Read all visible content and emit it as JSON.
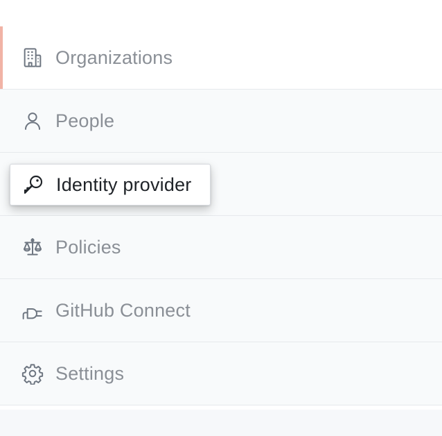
{
  "sidebar": {
    "items": [
      {
        "label": "Organizations",
        "icon": "organization-icon"
      },
      {
        "label": "People",
        "icon": "person-icon"
      },
      {
        "label": "Identity provider",
        "icon": "key-icon"
      },
      {
        "label": "Policies",
        "icon": "law-icon"
      },
      {
        "label": "GitHub Connect",
        "icon": "plug-icon"
      },
      {
        "label": "Settings",
        "icon": "gear-icon"
      }
    ],
    "selected_index": 0,
    "highlighted_index": 2
  },
  "colors": {
    "selected_indicator": "#f1b3a6",
    "muted_text": "#8a8f96",
    "active_text": "#1f2328",
    "icon_muted": "#6e7681"
  }
}
